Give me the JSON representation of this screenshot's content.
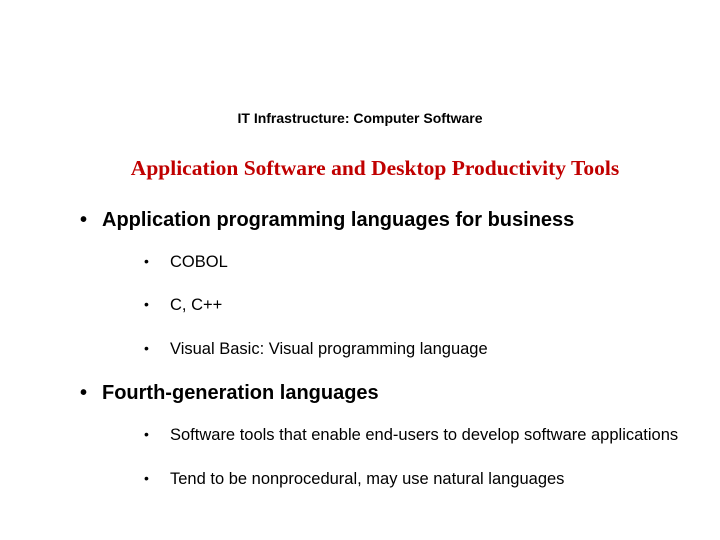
{
  "header": "IT Infrastructure: Computer Software",
  "title": "Application Software and Desktop Productivity Tools",
  "bullets": {
    "b1": {
      "label": "Application programming languages for business",
      "sub": {
        "s1": "COBOL",
        "s2": "C, C++",
        "s3": "Visual Basic: Visual programming language"
      }
    },
    "b2": {
      "label": "Fourth-generation languages",
      "sub": {
        "s1": "Software tools that enable end-users to develop software applications",
        "s2": "Tend to be nonprocedural, may use natural languages"
      }
    }
  }
}
